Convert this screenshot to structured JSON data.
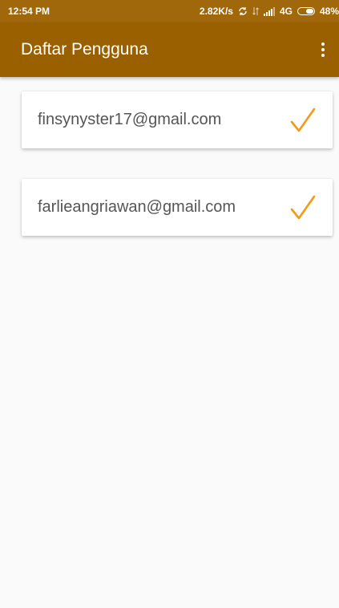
{
  "status_bar": {
    "time": "12:54 PM",
    "speed": "2.82K/s",
    "network": "4G",
    "battery": "48%"
  },
  "app_bar": {
    "title": "Daftar Pengguna",
    "menu_icon": "more-vert-icon"
  },
  "users": [
    {
      "email": "finsynyster17@gmail.com",
      "icon": "check-icon"
    },
    {
      "email": "farlieangriawan@gmail.com",
      "icon": "check-icon"
    }
  ],
  "colors": {
    "status_bar": "#a0680a",
    "app_bar": "#9a6000",
    "check": "#f39a12",
    "background": "#fafafa"
  }
}
